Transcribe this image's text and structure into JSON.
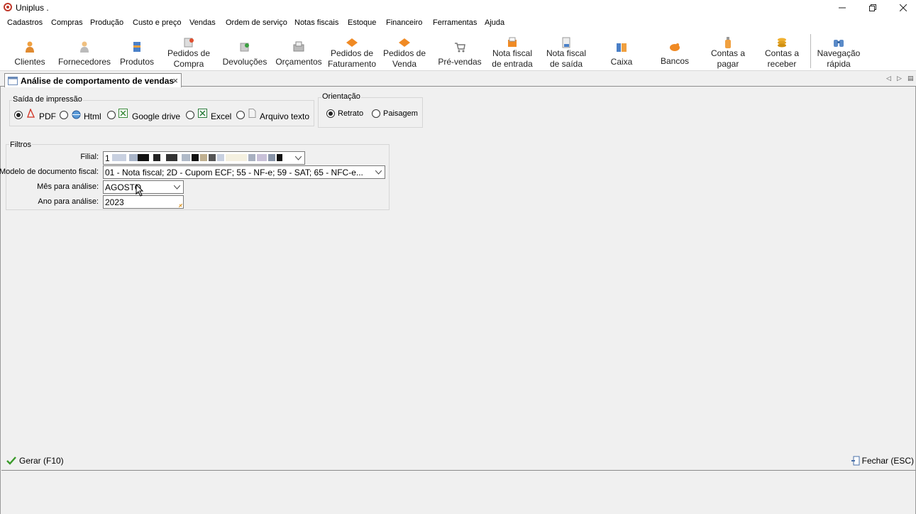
{
  "window": {
    "title": "Uniplus .",
    "minimize_icon": "minimize-icon",
    "restore_icon": "restore-icon",
    "close_icon": "close-icon"
  },
  "menu": {
    "items": [
      "Cadastros",
      "Compras",
      "Produção",
      "Custo e preço",
      "Vendas",
      "Ordem de serviço",
      "Notas fiscais",
      "Estoque",
      "Financeiro",
      "Ferramentas",
      "Ajuda"
    ]
  },
  "toolbar": {
    "items": [
      {
        "label": "Clientes",
        "icon": "person-icon"
      },
      {
        "label": "Fornecedores",
        "icon": "supplier-icon"
      },
      {
        "label": "Produtos",
        "icon": "box-icon"
      },
      {
        "label": "Pedidos de\nCompra",
        "icon": "purchase-order-icon"
      },
      {
        "label": "Devoluções",
        "icon": "return-icon"
      },
      {
        "label": "Orçamentos",
        "icon": "quote-icon"
      },
      {
        "label": "Pedidos de\nFaturamento",
        "icon": "billing-order-icon"
      },
      {
        "label": "Pedidos de\nVenda",
        "icon": "sales-order-icon"
      },
      {
        "label": "Pré-vendas",
        "icon": "cart-icon"
      },
      {
        "label": "Nota fiscal\nde entrada",
        "icon": "invoice-in-icon"
      },
      {
        "label": "Nota fiscal\nde saída",
        "icon": "invoice-out-icon"
      },
      {
        "label": "Caixa",
        "icon": "cashier-icon"
      },
      {
        "label": "Bancos",
        "icon": "bank-icon"
      },
      {
        "label": "Contas a\npagar",
        "icon": "bottle-icon"
      },
      {
        "label": "Contas a\nreceber",
        "icon": "coins-icon"
      },
      {
        "label": "Navegação\nrápida",
        "icon": "binoculars-icon"
      }
    ]
  },
  "tab": {
    "label": "Análise de comportamento de vendas",
    "close": "×"
  },
  "print_output": {
    "title": "Saída de impressão",
    "options": [
      {
        "label": "PDF",
        "selected": true
      },
      {
        "label": "Html",
        "selected": false
      },
      {
        "label": "Google drive",
        "selected": false
      },
      {
        "label": "Excel",
        "selected": false
      },
      {
        "label": "Arquivo texto",
        "selected": false
      }
    ]
  },
  "orientation": {
    "title": "Orientação",
    "options": [
      {
        "label": "Retrato",
        "selected": true
      },
      {
        "label": "Paisagem",
        "selected": false
      }
    ]
  },
  "filters": {
    "title": "Filtros",
    "filial_label": "Filial:",
    "filial_value": "1",
    "modelo_label": "Modelo de documento fiscal:",
    "modelo_value": "01 - Nota fiscal; 2D - Cupom ECF; 55 - NF-e; 59 - SAT; 65 - NFC-e...",
    "mes_label": "Mês para análise:",
    "mes_value": "AGOSTO",
    "ano_label": "Ano para análise:",
    "ano_value": "2023"
  },
  "actions": {
    "generate": "Gerar (F10)",
    "close": "Fechar (ESC)"
  },
  "colors": {
    "accent_orange": "#f08a24",
    "check_green": "#3a9a2a"
  }
}
